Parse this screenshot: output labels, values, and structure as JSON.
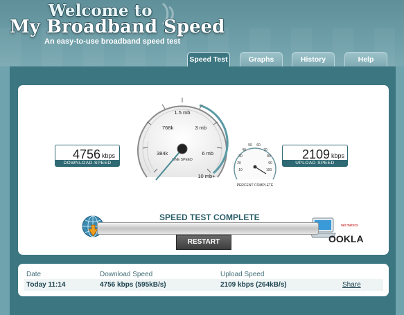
{
  "header": {
    "title_line1": "Welcome to",
    "title_line2": "My Broadband Speed",
    "tagline": "An easy-to-use broadband speed test"
  },
  "tabs": [
    {
      "label": "Speed Test",
      "active": true
    },
    {
      "label": "Graphs",
      "active": false
    },
    {
      "label": "History",
      "active": false
    },
    {
      "label": "Help",
      "active": false
    }
  ],
  "download": {
    "value": "4756",
    "unit": "kbps",
    "label": "DOWNLOAD SPEED"
  },
  "upload": {
    "value": "2109",
    "unit": "kbps",
    "label": "UPLOAD SPEED"
  },
  "line_speed_gauge": {
    "label": "LINE SPEED",
    "ticks": [
      "384k",
      "768k",
      "1.5 mb",
      "3 mb",
      "6 mb",
      "10 mb+"
    ]
  },
  "percent_gauge": {
    "label": "PERCENT COMPLETE",
    "ticks": [
      "10",
      "20",
      "30",
      "40",
      "50",
      "60",
      "70",
      "80",
      "90",
      "100"
    ]
  },
  "status": "SPEED TEST COMPLETE",
  "progress_fraction": 1.0,
  "restart_label": "RESTART",
  "branding": {
    "small": "net metrics",
    "logo": "OOKLA"
  },
  "results": {
    "headers": {
      "date": "Date",
      "download": "Download Speed",
      "upload": "Upload Speed"
    },
    "row": {
      "date": "Today 11:14",
      "download": "4756 kbps (595kB/s)",
      "upload": "2109 kbps (264kB/s)",
      "share": "Share"
    }
  },
  "colors": {
    "accent": "#3c7681",
    "header_bg": "#6e9ea8",
    "label_bg": "#2f6a74"
  }
}
